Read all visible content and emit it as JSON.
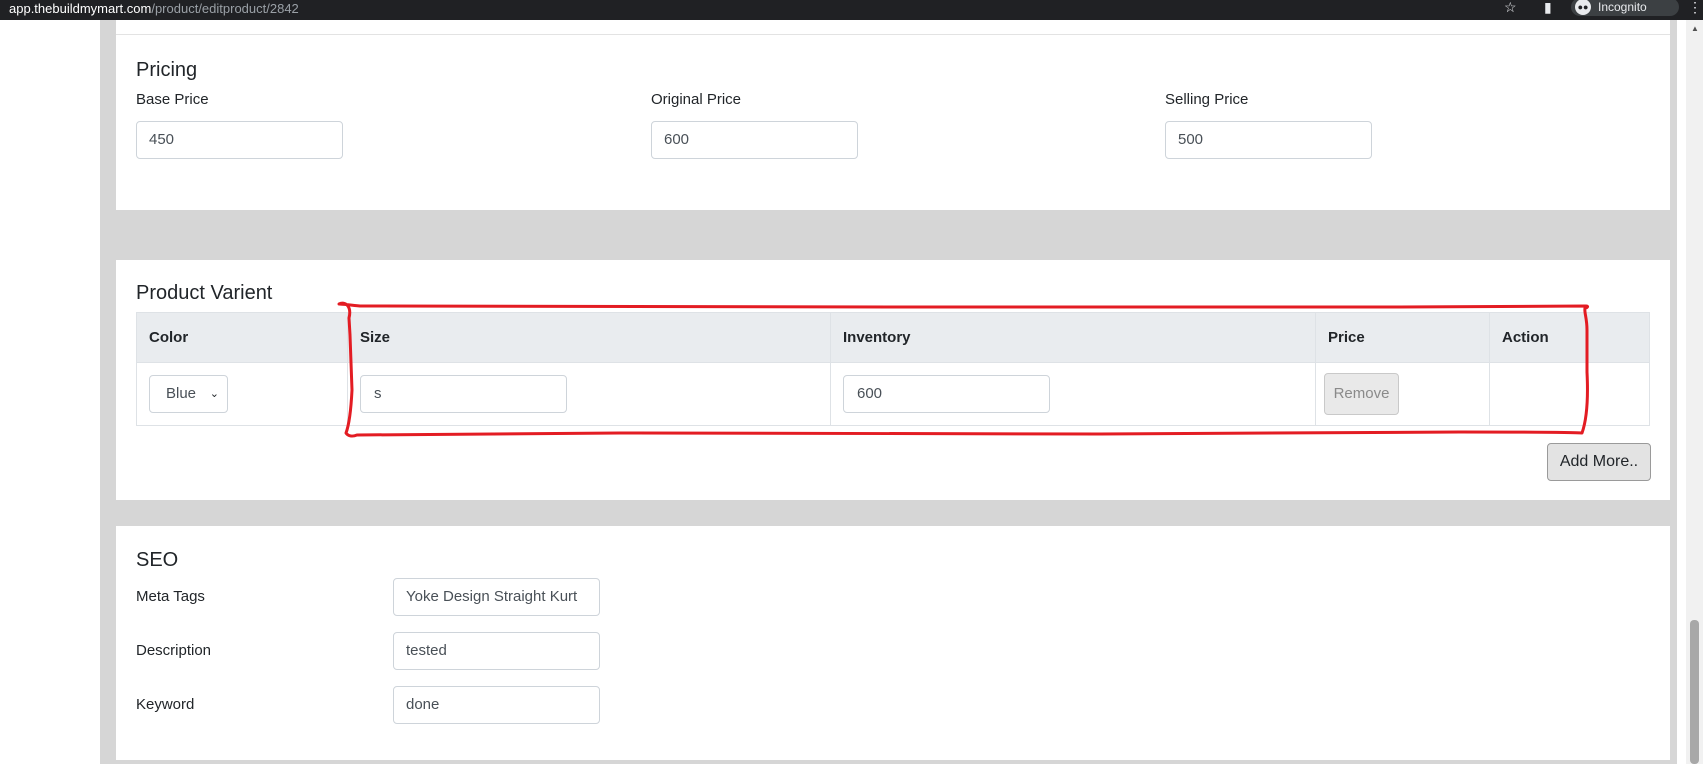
{
  "browser": {
    "url_host": "app.thebuildmymart.com",
    "url_path": "/product/editproduct/2842",
    "incognito_label": "Incognito"
  },
  "pricing": {
    "title": "Pricing",
    "base_price_label": "Base Price",
    "base_price_value": "450",
    "original_price_label": "Original Price",
    "original_price_value": "600",
    "selling_price_label": "Selling Price",
    "selling_price_value": "500"
  },
  "variant": {
    "title": "Product Varient",
    "columns": [
      "Color",
      "Size",
      "Inventory",
      "Price",
      "Action"
    ],
    "rows": [
      {
        "color": "Blue",
        "size": "s",
        "inventory": "600",
        "action_label": "Remove"
      }
    ],
    "add_more_label": "Add More..",
    "annotation_color": "#e31c23"
  },
  "seo": {
    "title": "SEO",
    "meta_tags_label": "Meta Tags",
    "meta_tags_value": "Yoke Design Straight Kurt",
    "description_label": "Description",
    "description_value": "tested",
    "keyword_label": "Keyword",
    "keyword_value": "done"
  }
}
